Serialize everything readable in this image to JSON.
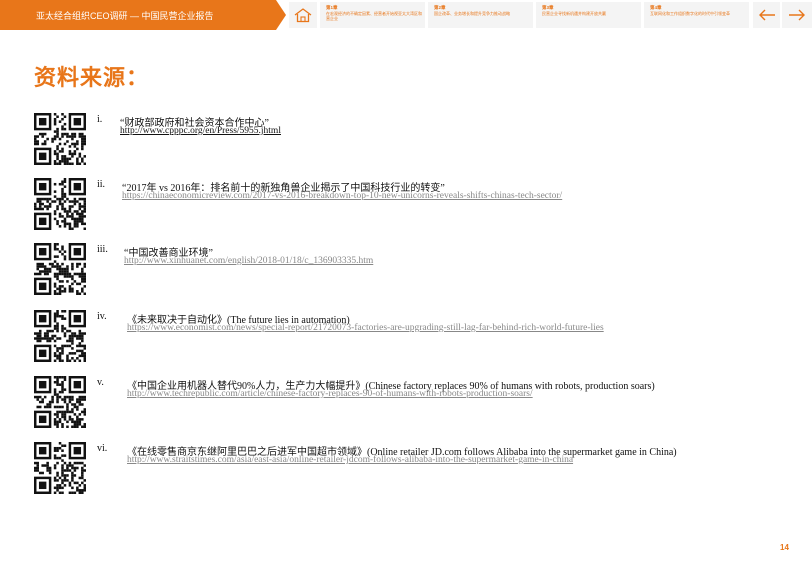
{
  "header": {
    "title": "亚太经合组织CEO调研 — 中国民营企业报告",
    "tabs": [
      {
        "num": "第1章",
        "text": "在宏观经济的不确定因素、经营者开始视亚太大湾区和营企业"
      },
      {
        "num": "第2章",
        "text": "国企改革、业务增长和提升竞争力推动战略"
      },
      {
        "num": "第3章",
        "text": "民营企业寻找新机遇并构建开放共赢"
      },
      {
        "num": "第4章",
        "text": "互联网化和工作组织数字化的时代中引领变革"
      }
    ]
  },
  "heading": "资料来源：",
  "refs": [
    {
      "roman": "i.",
      "title": "“财政部政府和社会资本合作中心”",
      "url": "http://www.cpppc.org/en/Press/5955.jhtml"
    },
    {
      "roman": "ii.",
      "title": "“2017年 vs 2016年：排名前十的新独角兽企业揭示了中国科技行业的转变”",
      "url": "https://chinaeconomicreview.com/2017-vs-2016-breakdown-top-10-new-unicorns-reveals-shifts-chinas-tech-sector/"
    },
    {
      "roman": "iii.",
      "title": "“中国改善商业环境”",
      "url": "http://www.xinhuanet.com/english/2018-01/18/c_136903335.htm"
    },
    {
      "roman": "iv.",
      "title": "《未来取决于自动化》(The future lies in automation)",
      "url": "https://www.economist.com/news/special-report/21720073-factories-are-upgrading-still-lag-far-behind-rich-world-future-lies"
    },
    {
      "roman": "v.",
      "title": "《中国企业用机器人替代90%人力，生产力大幅提升》(Chinese factory replaces 90% of humans with robots, production soars)",
      "url": "http://www.techrepublic.com/article/chinese-factory-replaces-90-of-humans-with-robots-production-soars/"
    },
    {
      "roman": "vi.",
      "title": "《在线零售商京东继阿里巴巴之后进军中国超市领域》(Online retailer JD.com follows Alibaba into the supermarket game in China)",
      "url": "http://www.straitstimes.com/asia/east-asia/online-retailer-jdcom-follows-alibaba-into-the-supermarket-game-in-china"
    }
  ],
  "page_number": "14",
  "colors": {
    "accent": "#e8761a"
  },
  "icons": {
    "home": "home-icon",
    "prev": "arrow-left-icon",
    "next": "arrow-right-icon",
    "qr": "qr-code-icon"
  }
}
